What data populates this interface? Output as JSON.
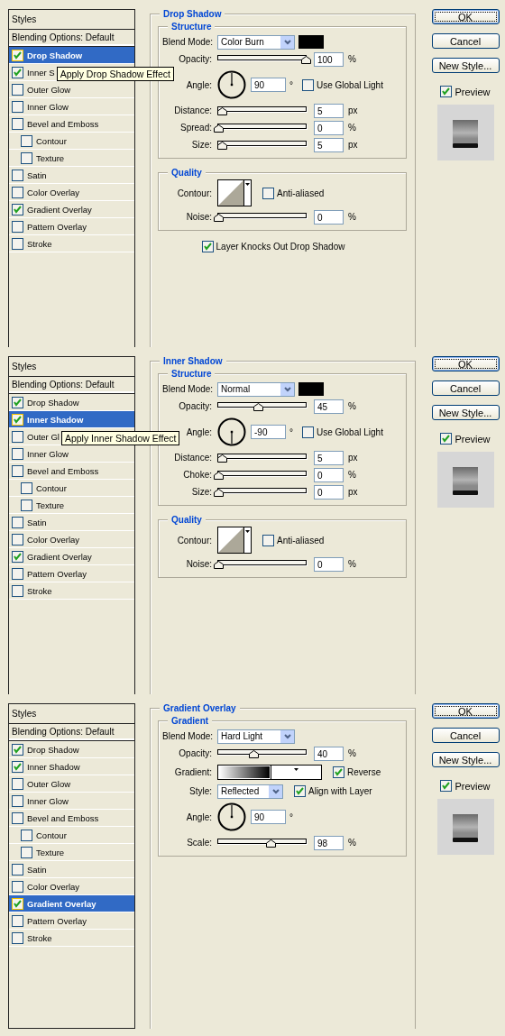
{
  "dialogs": [
    {
      "styles_header": "Styles",
      "blending": "Blending Options: Default",
      "effects": [
        {
          "label": "Drop Shadow",
          "checked": true,
          "selected": true
        },
        {
          "label": "Inner S",
          "checked": true,
          "selected": false,
          "tooltip": "Apply Drop Shadow Effect"
        },
        {
          "label": "Outer Glow",
          "checked": false,
          "selected": false
        },
        {
          "label": "Inner Glow",
          "checked": false,
          "selected": false
        },
        {
          "label": "Bevel and Emboss",
          "checked": false,
          "selected": false,
          "children": [
            {
              "label": "Contour",
              "checked": false,
              "selected": false
            },
            {
              "label": "Texture",
              "checked": false,
              "selected": false
            }
          ]
        },
        {
          "label": "Satin",
          "checked": false,
          "selected": false
        },
        {
          "label": "Color Overlay",
          "checked": false,
          "selected": false
        },
        {
          "label": "Gradient Overlay",
          "checked": true,
          "selected": false
        },
        {
          "label": "Pattern Overlay",
          "checked": false,
          "selected": false
        },
        {
          "label": "Stroke",
          "checked": false,
          "selected": false
        }
      ],
      "panel": {
        "title": "Drop Shadow",
        "groups": [
          {
            "title": "Structure",
            "rows": [
              {
                "kind": "dropdown",
                "label": "Blend Mode:",
                "value": "Color Burn",
                "color": "#000000"
              },
              {
                "kind": "slider",
                "label": "Opacity:",
                "level": 1,
                "value": "100",
                "unit": "%"
              },
              {
                "kind": "angle",
                "label": "Angle:",
                "value": "90",
                "unit": "°",
                "checkbox": {
                  "label": "Use Global Light",
                  "checked": false
                }
              },
              {
                "kind": "slider",
                "label": "Distance:",
                "level": 0.04,
                "value": "5",
                "unit": "px"
              },
              {
                "kind": "slider",
                "label": "Spread:",
                "level": 0,
                "value": "0",
                "unit": "%"
              },
              {
                "kind": "slider",
                "label": "Size:",
                "level": 0.04,
                "value": "5",
                "unit": "px"
              }
            ]
          },
          {
            "title": "Quality",
            "rows": [
              {
                "kind": "contour",
                "label": "Contour:",
                "checkbox": {
                  "label": "Anti-aliased",
                  "checked": false
                }
              },
              {
                "kind": "slider",
                "label": "Noise:",
                "level": 0,
                "value": "0",
                "unit": "%"
              }
            ]
          }
        ],
        "footer_checkbox": {
          "label": "Layer Knocks Out Drop Shadow",
          "checked": true
        }
      },
      "buttons": [
        {
          "label": "OK",
          "default": true
        },
        {
          "label": "Cancel",
          "default": false
        },
        {
          "label": "New Style...",
          "default": false
        }
      ],
      "preview": {
        "label": "Preview",
        "checked": true
      }
    },
    {
      "styles_header": "Styles",
      "blending": "Blending Options: Default",
      "effects": [
        {
          "label": "Drop Shadow",
          "checked": true,
          "selected": false
        },
        {
          "label": "Inner Shadow",
          "checked": true,
          "selected": true
        },
        {
          "label": "Outer Gl",
          "checked": false,
          "selected": false,
          "tooltip": "Apply Inner Shadow Effect"
        },
        {
          "label": "Inner Glow",
          "checked": false,
          "selected": false
        },
        {
          "label": "Bevel and Emboss",
          "checked": false,
          "selected": false,
          "children": [
            {
              "label": "Contour",
              "checked": false,
              "selected": false
            },
            {
              "label": "Texture",
              "checked": false,
              "selected": false
            }
          ]
        },
        {
          "label": "Satin",
          "checked": false,
          "selected": false
        },
        {
          "label": "Color Overlay",
          "checked": false,
          "selected": false
        },
        {
          "label": "Gradient Overlay",
          "checked": true,
          "selected": false
        },
        {
          "label": "Pattern Overlay",
          "checked": false,
          "selected": false
        },
        {
          "label": "Stroke",
          "checked": false,
          "selected": false
        }
      ],
      "panel": {
        "title": "Inner Shadow",
        "groups": [
          {
            "title": "Structure",
            "rows": [
              {
                "kind": "dropdown",
                "label": "Blend Mode:",
                "value": "Normal",
                "color": "#000000"
              },
              {
                "kind": "slider",
                "label": "Opacity:",
                "level": 0.45,
                "value": "45",
                "unit": "%"
              },
              {
                "kind": "angle",
                "label": "Angle:",
                "value": "-90",
                "unit": "°",
                "checkbox": {
                  "label": "Use Global Light",
                  "checked": false
                }
              },
              {
                "kind": "slider",
                "label": "Distance:",
                "level": 0.04,
                "value": "5",
                "unit": "px"
              },
              {
                "kind": "slider",
                "label": "Choke:",
                "level": 0,
                "value": "0",
                "unit": "%"
              },
              {
                "kind": "slider",
                "label": "Size:",
                "level": 0,
                "value": "0",
                "unit": "px"
              }
            ]
          },
          {
            "title": "Quality",
            "rows": [
              {
                "kind": "contour",
                "label": "Contour:",
                "checkbox": {
                  "label": "Anti-aliased",
                  "checked": false
                }
              },
              {
                "kind": "slider",
                "label": "Noise:",
                "level": 0,
                "value": "0",
                "unit": "%"
              }
            ]
          }
        ]
      },
      "buttons": [
        {
          "label": "OK",
          "default": true
        },
        {
          "label": "Cancel",
          "default": false
        },
        {
          "label": "New Style...",
          "default": false
        }
      ],
      "preview": {
        "label": "Preview",
        "checked": true
      }
    },
    {
      "styles_header": "Styles",
      "blending": "Blending Options: Default",
      "effects": [
        {
          "label": "Drop Shadow",
          "checked": true,
          "selected": false
        },
        {
          "label": "Inner Shadow",
          "checked": true,
          "selected": false
        },
        {
          "label": "Outer Glow",
          "checked": false,
          "selected": false
        },
        {
          "label": "Inner Glow",
          "checked": false,
          "selected": false
        },
        {
          "label": "Bevel and Emboss",
          "checked": false,
          "selected": false,
          "children": [
            {
              "label": "Contour",
              "checked": false,
              "selected": false
            },
            {
              "label": "Texture",
              "checked": false,
              "selected": false
            }
          ]
        },
        {
          "label": "Satin",
          "checked": false,
          "selected": false
        },
        {
          "label": "Color Overlay",
          "checked": false,
          "selected": false
        },
        {
          "label": "Gradient Overlay",
          "checked": true,
          "selected": true
        },
        {
          "label": "Pattern Overlay",
          "checked": false,
          "selected": false
        },
        {
          "label": "Stroke",
          "checked": false,
          "selected": false
        }
      ],
      "panel": {
        "title": "Gradient Overlay",
        "groups": [
          {
            "title": "Gradient",
            "rows": [
              {
                "kind": "dropdown",
                "label": "Blend Mode:",
                "value": "Hard Light"
              },
              {
                "kind": "slider",
                "label": "Opacity:",
                "level": 0.4,
                "value": "40",
                "unit": "%"
              },
              {
                "kind": "gradient",
                "label": "Gradient:",
                "checkbox": {
                  "label": "Reverse",
                  "checked": true
                }
              },
              {
                "kind": "dropdown",
                "label": "Style:",
                "value": "Reflected",
                "checkbox": {
                  "label": "Align with Layer",
                  "checked": true
                }
              },
              {
                "kind": "angle",
                "label": "Angle:",
                "value": "90",
                "unit": "°"
              },
              {
                "kind": "slider",
                "label": "Scale:",
                "level": 0.6,
                "value": "98",
                "unit": "%"
              }
            ]
          }
        ]
      },
      "buttons": [
        {
          "label": "OK",
          "default": true
        },
        {
          "label": "Cancel",
          "default": false
        },
        {
          "label": "New Style...",
          "default": false
        }
      ],
      "preview": {
        "label": "Preview",
        "checked": true
      }
    }
  ]
}
